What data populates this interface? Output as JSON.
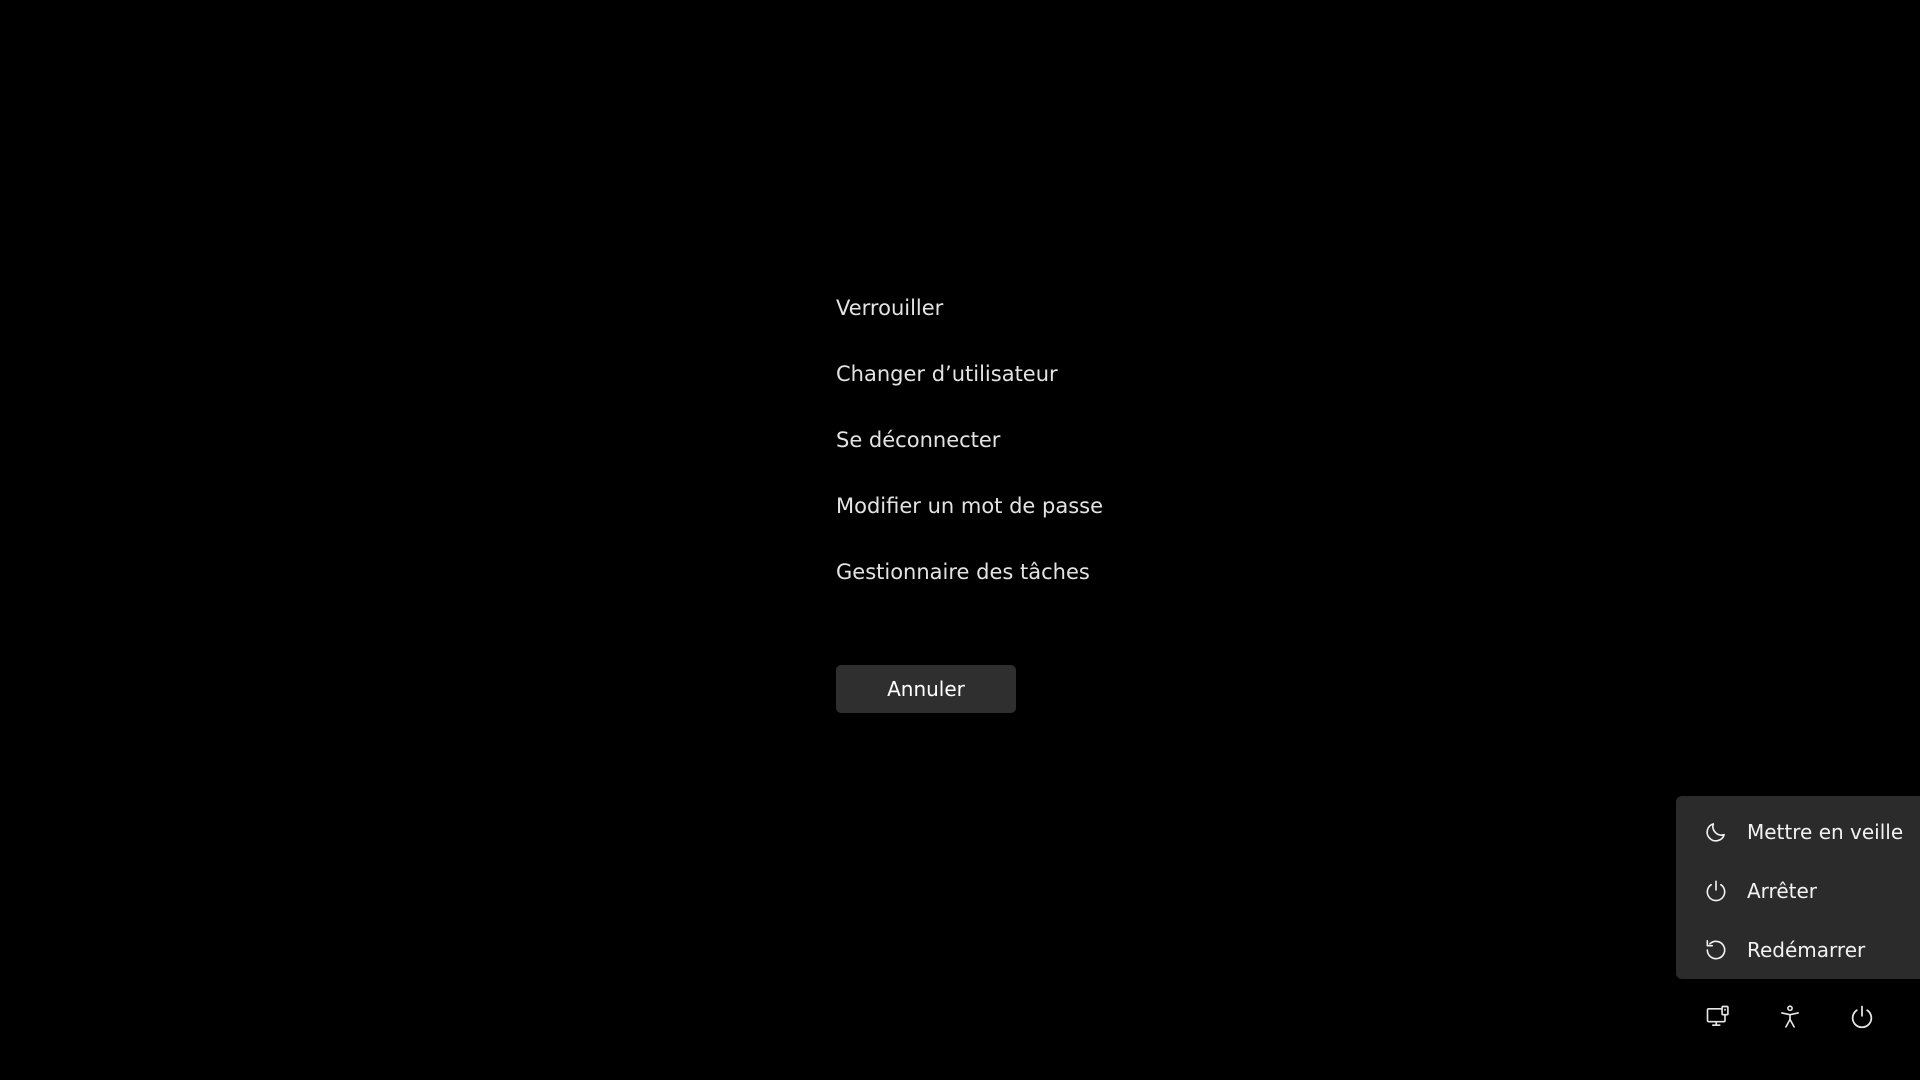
{
  "options": [
    {
      "label": "Verrouiller"
    },
    {
      "label": "Changer d’utilisateur"
    },
    {
      "label": "Se déconnecter"
    },
    {
      "label": "Modifier un mot de passe"
    },
    {
      "label": "Gestionnaire des tâches"
    }
  ],
  "cancel_label": "Annuler",
  "power_menu": {
    "items": [
      {
        "label": "Mettre en veille",
        "icon": "moon-icon"
      },
      {
        "label": "Arrêter",
        "icon": "power-icon"
      },
      {
        "label": "Redémarrer",
        "icon": "restart-icon"
      }
    ]
  },
  "tray": {
    "icons": [
      "network-icon",
      "accessibility-icon",
      "power-icon"
    ]
  },
  "colors": {
    "background": "#000000",
    "menu_background": "#2b2b2b",
    "button_background": "#2f2f2f",
    "text": "#e3e3e3"
  }
}
